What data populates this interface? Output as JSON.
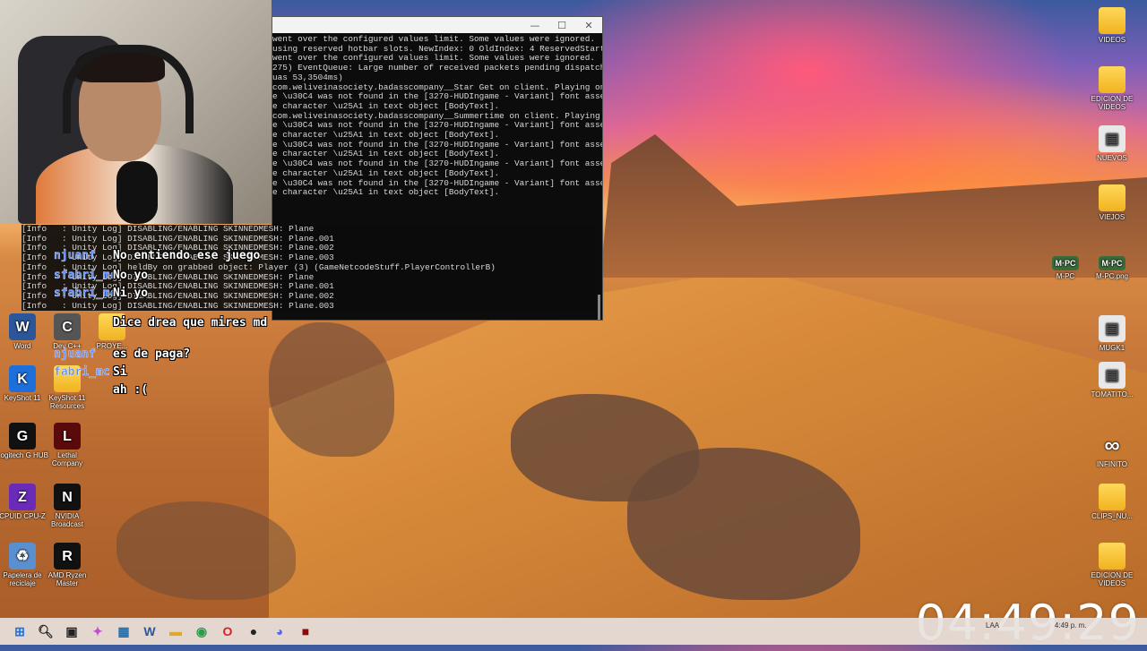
{
  "console": {
    "lines": [
      "went over the configured values limit. Some values were ignored.",
      "using reserved hotbar slots. NewIndex: 0 OldIndex: 4 ReservedStartI",
      "",
      "went over the configured values limit. Some values were ignored.",
      "275) EventQueue: Large number of received packets pending dispatch (",
      "uas 53,3504ms)",
      "com.weliveinasociety.badasscompany__Star Get on client. Playing on",
      "",
      "e \\u30C4 was not found in the [3270-HUDIngame - Variant] font asset",
      "e character \\u25A1 in text object [BodyText].",
      "com.weliveinasociety.badasscompany__Summertime on client. Playing o",
      "",
      "e \\u30C4 was not found in the [3270-HUDIngame - Variant] font asset",
      "e character \\u25A1 in text object [BodyText].",
      "e \\u30C4 was not found in the [3270-HUDIngame - Variant] font asset",
      "e character \\u25A1 in text object [BodyText].",
      "e \\u30C4 was not found in the [3270-HUDIngame - Variant] font asset",
      "e character \\u25A1 in text object [BodyText].",
      "e \\u30C4 was not found in the [3270-HUDIngame - Variant] font asset",
      "e character \\u25A1 in text object [BodyText]."
    ],
    "log_below": [
      "[Info   : Unity Log] DISABLING/ENABLING SKINNEDMESH: Plane",
      "[Info   : Unity Log] DISABLING/ENABLING SKINNEDMESH: Plane.001",
      "[Info   : Unity Log] DISABLING/ENABLING SKINNEDMESH: Plane.002",
      "[Info   : Unity Log] DISABLING/ENABLING SKINNEDMESH: Plane.003",
      "[Info   : Unity Log] heldBy on grabbed object: Player (3) (GameNetcodeStuff.PlayerControllerB)",
      "[Info   : Unity Log] DISABLING/ENABLING SKINNEDMESH: Plane",
      "[Info   : Unity Log] DISABLING/ENABLING SKINNEDMESH: Plane.001",
      "[Info   : Unity Log] DISABLING/ENABLING SKINNEDMESH: Plane.002",
      "[Info   : Unity Log] DISABLING/ENABLING SKINNEDMESH: Plane.003"
    ]
  },
  "chat": [
    {
      "user": "njuanf",
      "text": "No entiendo ese juego"
    },
    {
      "user": "sfabri_mc",
      "text": "No yo"
    },
    {
      "user": "sfabri_mc",
      "text": "Ni yo"
    },
    {
      "user": "",
      "text": "Dice drea que mires md"
    },
    {
      "user": "njuanf",
      "text": "es de paga?"
    },
    {
      "user": "fabri_mc",
      "text": "Si"
    },
    {
      "user": "",
      "text": "ah :("
    }
  ],
  "desktop_left": [
    {
      "label": "Word",
      "icon": "word-icon",
      "color": "#2b579a",
      "glyph": "W"
    },
    {
      "label": "Dev C++",
      "icon": "devcpp-icon",
      "color": "#555",
      "glyph": "C"
    },
    {
      "label": "PROYE...",
      "icon": "folder-icon",
      "color": "",
      "glyph": ""
    },
    {
      "label": "KeyShot 11",
      "icon": "keyshot-icon",
      "color": "#1e6fd9",
      "glyph": "K"
    },
    {
      "label": "KeyShot 11 Resources",
      "icon": "folder-icon",
      "color": "",
      "glyph": ""
    },
    {
      "label": "Logitech G HUB",
      "icon": "logitech-icon",
      "color": "#111",
      "glyph": "G"
    },
    {
      "label": "Lethal Company",
      "icon": "lethal-company-icon",
      "color": "#5a0a0a",
      "glyph": "L"
    },
    {
      "label": "CPUID CPU-Z",
      "icon": "cpuz-icon",
      "color": "#6a2bb8",
      "glyph": "Z"
    },
    {
      "label": "NVIDIA Broadcast",
      "icon": "nvidia-icon",
      "color": "#111",
      "glyph": "N"
    },
    {
      "label": "Papelera de reciclaje",
      "icon": "recycle-bin-icon",
      "color": "#5a8fd0",
      "glyph": "♻"
    },
    {
      "label": "AMD Ryzen Master",
      "icon": "ryzen-icon",
      "color": "#111",
      "glyph": "R"
    }
  ],
  "desktop_right": [
    {
      "label": "VIDEOS",
      "icon": "folder-icon"
    },
    {
      "label": "EDICION DE VIDEOS",
      "icon": "folder-icon"
    },
    {
      "label": "NUEVOS",
      "icon": "image-icon"
    },
    {
      "label": "VIEJOS",
      "icon": "folder-icon"
    },
    {
      "label": "M-PC",
      "icon": "mpc-icon"
    },
    {
      "label": "M-PC.png",
      "icon": "mpc-png-icon"
    },
    {
      "label": "MUGK1",
      "icon": "image-icon"
    },
    {
      "label": "TOMATITO...",
      "icon": "image-icon"
    },
    {
      "label": "INFINITO",
      "icon": "infinity-icon"
    },
    {
      "label": "CLIPS_NU...",
      "icon": "folder-icon"
    },
    {
      "label": "EDICION DE VIDEOS",
      "icon": "folder-icon"
    }
  ],
  "taskbar": [
    {
      "name": "start-icon",
      "glyph": "⊞",
      "color": "#1a73e8"
    },
    {
      "name": "search-icon",
      "glyph": "🔍︎",
      "color": "#222"
    },
    {
      "name": "task-view-icon",
      "glyph": "▣",
      "color": "#222"
    },
    {
      "name": "copilot-icon",
      "glyph": "✦",
      "color": "#c04fd0"
    },
    {
      "name": "store-icon",
      "glyph": "▦",
      "color": "#1a6fb5"
    },
    {
      "name": "word-icon",
      "glyph": "W",
      "color": "#2b579a"
    },
    {
      "name": "explorer-icon",
      "glyph": "▬",
      "color": "#e0a82a"
    },
    {
      "name": "chrome-icon",
      "glyph": "◉",
      "color": "#2a9d4a"
    },
    {
      "name": "opera-icon",
      "glyph": "O",
      "color": "#d92027"
    },
    {
      "name": "obs-icon",
      "glyph": "●",
      "color": "#222"
    },
    {
      "name": "discord-icon",
      "glyph": "◕",
      "color": "#5865f2"
    },
    {
      "name": "lethal-company-icon",
      "glyph": "■",
      "color": "#8a0a0a"
    }
  ],
  "clock": "04:49:29",
  "tray": {
    "lang": "LAA",
    "time": "4:49 p. m."
  }
}
